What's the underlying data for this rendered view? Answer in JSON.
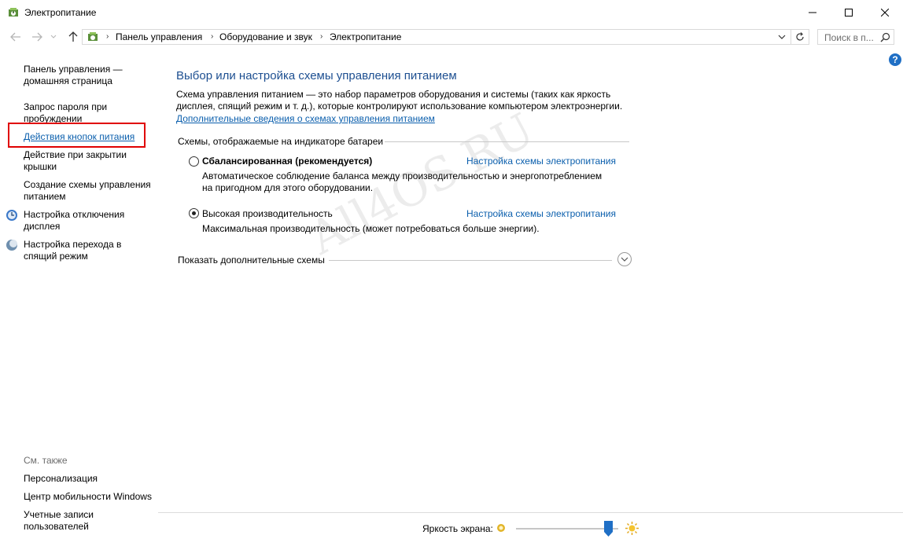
{
  "window": {
    "title": "Электропитание"
  },
  "address_bar": {
    "crumbs": [
      "Панель управления",
      "Оборудование и звук",
      "Электропитание"
    ]
  },
  "search": {
    "placeholder": "Поиск в п..."
  },
  "help": {
    "label": "?"
  },
  "sidebar": {
    "items": [
      {
        "label_line1": "Панель управления —",
        "label_line2": "домашняя страница"
      },
      {
        "label_line1": "Запрос пароля при",
        "label_line2": "пробуждении"
      },
      {
        "label_line1": "Действия кнопок питания"
      },
      {
        "label_line1": "Действие при закрытии",
        "label_line2": "крышки"
      },
      {
        "label_line1": "Создание схемы управления",
        "label_line2": "питанием"
      },
      {
        "label_line1": "Настройка отключения",
        "label_line2": "дисплея"
      },
      {
        "label_line1": "Настройка перехода в",
        "label_line2": "спящий режим"
      }
    ],
    "see_also": {
      "heading": "См. также",
      "items": [
        {
          "label_line1": "Персонализация"
        },
        {
          "label_line1": "Центр мобильности Windows"
        },
        {
          "label_line1": "Учетные записи",
          "label_line2": "пользователей"
        }
      ]
    }
  },
  "main": {
    "title": "Выбор или настройка схемы управления питанием",
    "desc_line1": "Схема управления питанием — это набор параметров оборудования и системы (таких как яркость",
    "desc_line2": "дисплея, спящий режим и т. д.), которые контролируют использование компьютером электроэнергии.",
    "more_link": "Дополнительные сведения о схемах управления питанием",
    "group_label": "Схемы, отображаемые на индикаторе батареи",
    "plans": [
      {
        "name": "Сбалансированная (рекомендуется)",
        "link": "Настройка схемы электропитания",
        "desc_line1": "Автоматическое соблюдение баланса между производительностью и энергопотреблением",
        "desc_line2": "на пригодном для этого оборудовании.",
        "selected": false
      },
      {
        "name": "Высокая производительность",
        "link": "Настройка схемы электропитания",
        "desc_line1": "Максимальная производительность (может потребоваться больше энергии).",
        "selected": true
      }
    ],
    "show_more": "Показать дополнительные схемы"
  },
  "brightness": {
    "label": "Яркость экрана:",
    "level_fraction": 0.9
  },
  "watermark": "All4OS.RU",
  "colors": {
    "link": "#0b5fad",
    "title": "#1d4f91",
    "highlight": "#e00000"
  }
}
